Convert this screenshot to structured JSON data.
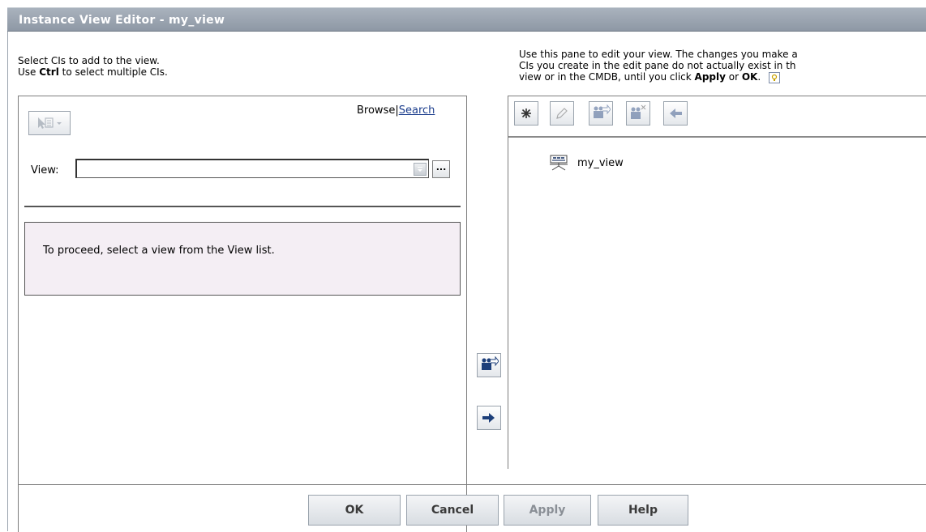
{
  "window": {
    "title": "Instance View Editor - my_view"
  },
  "left_pane": {
    "instruction_line1": "Select CIs to add to the view.",
    "instruction_line2_pre": "Use ",
    "instruction_line2_key": "Ctrl",
    "instruction_line2_post": " to select multiple CIs.",
    "browse_label": "Browse",
    "separator": "|",
    "search_label": "Search",
    "view_label": "View:",
    "view_value": "",
    "ellipsis_label": "...",
    "message": "To proceed, select a view from the View list."
  },
  "right_pane": {
    "instruction_line1": "Use this pane to edit your view. The changes you make a",
    "instruction_line2": "CIs you create in the edit pane do not actually exist in th",
    "instruction_line3_pre": "view or in the CMDB, until you click ",
    "instruction_apply": "Apply",
    "instruction_or": " or ",
    "instruction_ok": "OK",
    "instruction_end": ".",
    "tree_root": "my_view",
    "toolbar_icons": [
      "new-ci-icon",
      "edit-icon",
      "add-related-icon",
      "remove-ci-icon",
      "back-arrow-icon"
    ]
  },
  "footer": {
    "ok_label": "OK",
    "cancel_label": "Cancel",
    "apply_label": "Apply",
    "help_label": "Help"
  },
  "colors": {
    "titlebar": "#9ba4b0",
    "message_bg": "#f4eef4",
    "link": "#1a3c8c"
  }
}
